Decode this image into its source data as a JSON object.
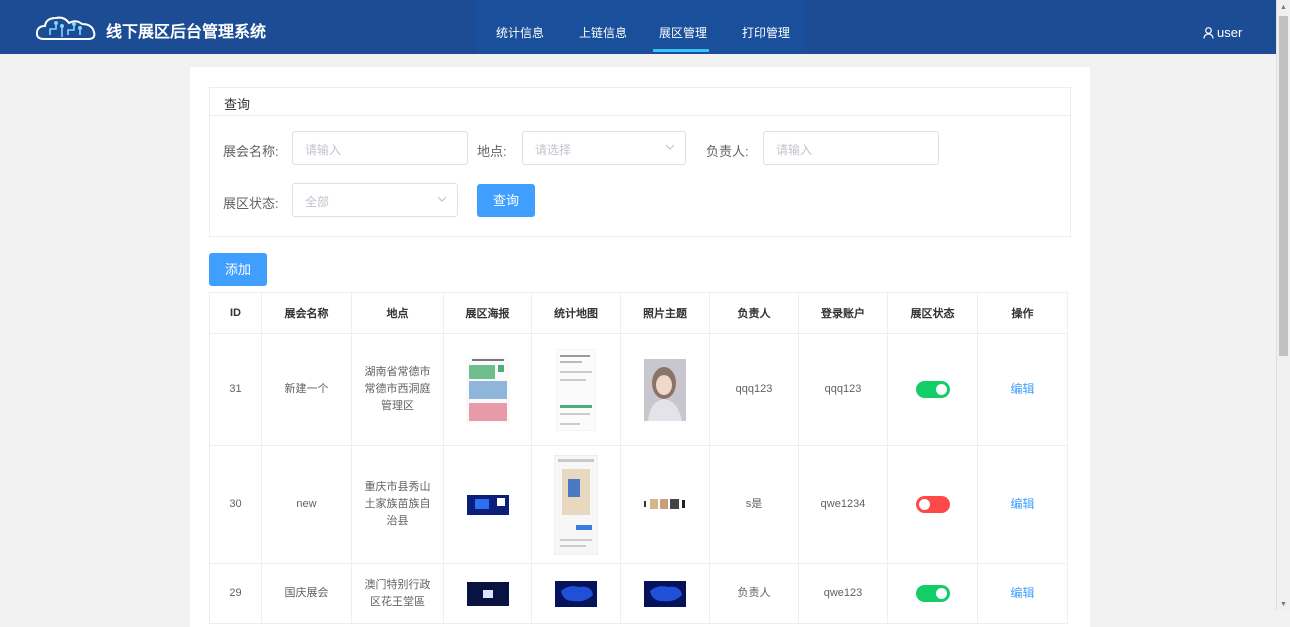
{
  "app": {
    "title": "线下展区后台管理系统"
  },
  "nav": {
    "items": [
      {
        "label": "统计信息"
      },
      {
        "label": "上链信息"
      },
      {
        "label": "展区管理",
        "active": true
      },
      {
        "label": "打印管理"
      }
    ]
  },
  "user": {
    "name": "user",
    "icon": "user-icon"
  },
  "query": {
    "title": "查询",
    "name_label": "展会名称:",
    "name_placeholder": "请输入",
    "place_label": "地点:",
    "place_placeholder": "请选择",
    "owner_label": "负责人:",
    "owner_placeholder": "请输入",
    "status_label": "展区状态:",
    "status_value": "全部",
    "search_button": "查询"
  },
  "add_button": "添加",
  "table": {
    "headers": [
      "ID",
      "展会名称",
      "地点",
      "展区海报",
      "统计地图",
      "照片主题",
      "负责人",
      "登录账户",
      "展区状态",
      "操作"
    ],
    "rows": [
      {
        "id": "31",
        "name": "新建一个",
        "place": "湖南省常德市常德市西洞庭管理区",
        "owner": "qqq123",
        "account": "qqq123",
        "status": "on",
        "action": "编辑"
      },
      {
        "id": "30",
        "name": "new",
        "place": "重庆市县秀山土家族苗族自治县",
        "owner": "s是",
        "account": "qwe1234",
        "status": "off",
        "action": "编辑"
      },
      {
        "id": "29",
        "name": "国庆展会",
        "place": "澳门特别行政区花王堂區",
        "owner": "负责人",
        "account": "qwe123",
        "status": "on",
        "action": "编辑"
      }
    ]
  },
  "colors": {
    "header": "#1c4c93",
    "accent": "#409eff",
    "toggle_on": "#13ce66",
    "toggle_off": "#ff4949",
    "nav_active": "#3ec2f8"
  }
}
